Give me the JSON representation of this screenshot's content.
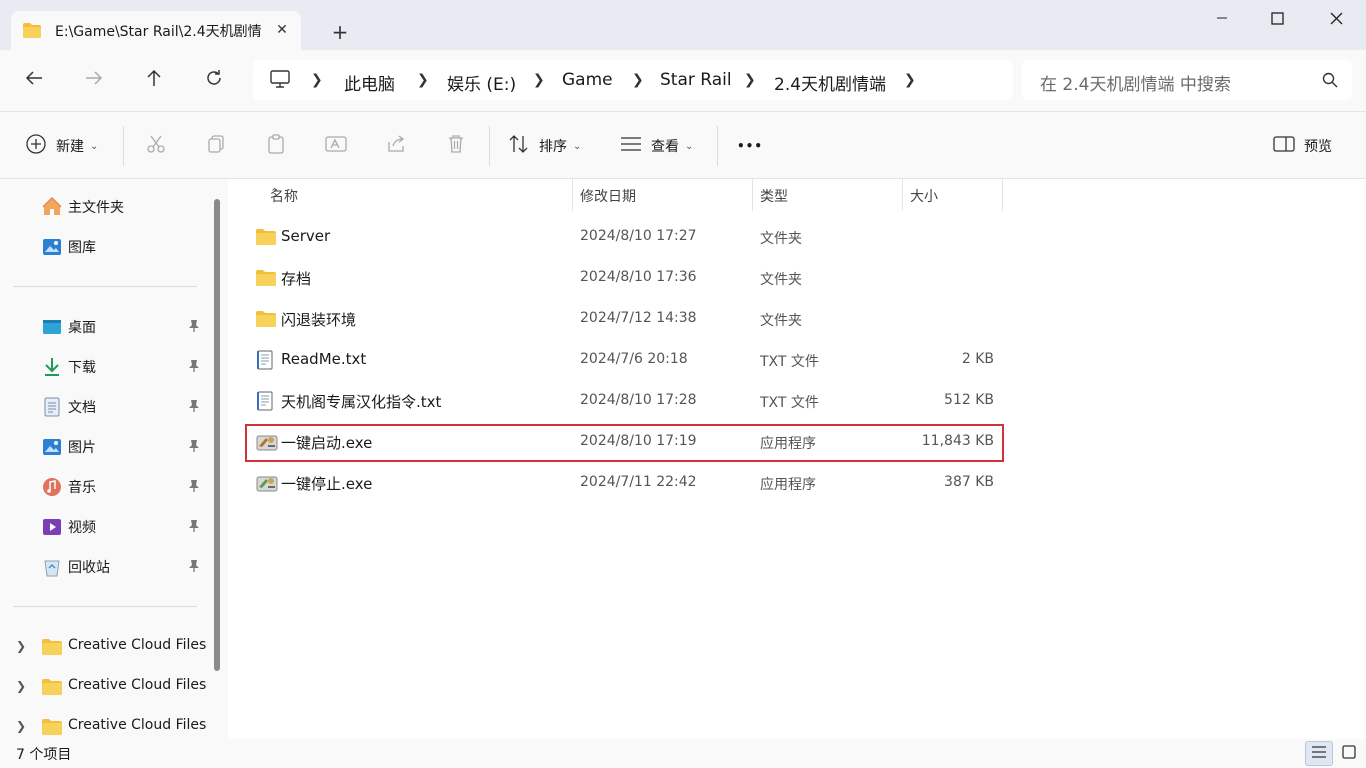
{
  "tab": {
    "title": "E:\\Game\\Star Rail\\2.4天机剧情",
    "close_icon": "close-icon",
    "new_tab": "+"
  },
  "window": {
    "minimize": "minimize-icon",
    "maximize": "maximize-icon",
    "close": "close-icon"
  },
  "breadcrumb": [
    "此电脑",
    "娱乐 (E:)",
    "Game",
    "Star Rail",
    "2.4天机剧情端"
  ],
  "search": {
    "placeholder": "在 2.4天机剧情端 中搜索"
  },
  "toolbar": {
    "new_label": "新建",
    "sort_label": "排序",
    "view_label": "查看",
    "more_label": "•••",
    "preview_label": "预览"
  },
  "sidebar": {
    "top": [
      {
        "label": "主文件夹",
        "icon": "home-icon"
      },
      {
        "label": "图库",
        "icon": "gallery-icon"
      }
    ],
    "pinned": [
      {
        "label": "桌面",
        "icon": "desktop-icon"
      },
      {
        "label": "下载",
        "icon": "download-icon"
      },
      {
        "label": "文档",
        "icon": "document-icon"
      },
      {
        "label": "图片",
        "icon": "pictures-icon"
      },
      {
        "label": "音乐",
        "icon": "music-icon"
      },
      {
        "label": "视频",
        "icon": "video-icon"
      },
      {
        "label": "回收站",
        "icon": "recycle-bin-icon"
      }
    ],
    "cloud": [
      {
        "label": "Creative Cloud Files"
      },
      {
        "label": "Creative Cloud Files"
      },
      {
        "label": "Creative Cloud Files"
      }
    ]
  },
  "columns": {
    "name": "名称",
    "date": "修改日期",
    "type": "类型",
    "size": "大小"
  },
  "files": [
    {
      "name": "Server",
      "date": "2024/8/10 17:27",
      "type": "文件夹",
      "size": "",
      "icon": "folder-icon"
    },
    {
      "name": "存档",
      "date": "2024/8/10 17:36",
      "type": "文件夹",
      "size": "",
      "icon": "folder-icon"
    },
    {
      "name": "闪退装环境",
      "date": "2024/7/12 14:38",
      "type": "文件夹",
      "size": "",
      "icon": "folder-icon"
    },
    {
      "name": "ReadMe.txt",
      "date": "2024/7/6 20:18",
      "type": "TXT 文件",
      "size": "2 KB",
      "icon": "text-file-icon"
    },
    {
      "name": "天机阁专属汉化指令.txt",
      "date": "2024/8/10 17:28",
      "type": "TXT 文件",
      "size": "512 KB",
      "icon": "text-file-icon"
    },
    {
      "name": "一键启动.exe",
      "date": "2024/8/10 17:19",
      "type": "应用程序",
      "size": "11,843 KB",
      "icon": "executable-icon"
    },
    {
      "name": "一键停止.exe",
      "date": "2024/7/11 22:42",
      "type": "应用程序",
      "size": "387 KB",
      "icon": "executable-icon"
    }
  ],
  "status": {
    "item_count": "7 个项目"
  },
  "colors": {
    "highlight": "#d0323a",
    "folder": "#f2c037"
  }
}
